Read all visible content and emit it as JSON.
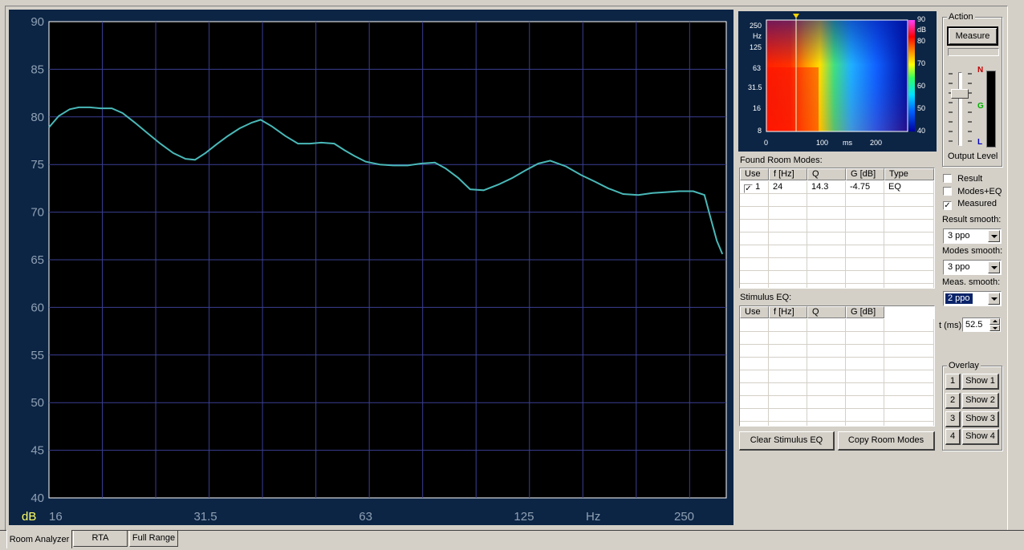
{
  "main_graph": {
    "y_ticks": [
      "90",
      "85",
      "80",
      "75",
      "70",
      "65",
      "60",
      "55",
      "50",
      "45",
      "40"
    ],
    "x_ticks": [
      "16",
      "31.5",
      "63",
      "125",
      "250"
    ],
    "y_unit": "dB",
    "x_unit": "Hz",
    "grid_color": "#3b3f94",
    "trace_color": "#4ab8b8",
    "background": "#000000"
  },
  "chart_data": {
    "type": "line",
    "title": "",
    "xlabel": "Hz",
    "ylabel": "dB",
    "x_scale": "log",
    "xlim": [
      16,
      300
    ],
    "ylim": [
      40,
      90
    ],
    "grid": true,
    "series": [
      {
        "x": [
          16,
          16.7,
          17.5,
          18.2,
          19.1,
          20,
          21,
          22,
          23.2,
          24.5,
          25.9,
          27.4,
          28.9,
          30.1,
          31.5,
          33,
          34.7,
          36.5,
          38.5,
          40,
          42,
          44.5,
          47,
          49.5,
          52,
          55,
          57.5,
          60,
          63,
          67,
          71,
          75.5,
          80,
          85,
          89,
          94,
          99,
          105,
          112,
          119,
          126,
          133,
          140,
          150,
          160,
          170,
          180,
          192,
          205,
          218,
          230,
          245,
          260,
          273,
          280,
          288,
          295
        ],
        "y": [
          78.9,
          80.1,
          80.8,
          81.0,
          81.0,
          80.9,
          80.9,
          80.4,
          79.4,
          78.3,
          77.2,
          76.2,
          75.6,
          75.5,
          76.2,
          77.1,
          78.0,
          78.8,
          79.4,
          79.7,
          79.0,
          78.0,
          77.2,
          77.2,
          77.3,
          77.2,
          76.5,
          75.9,
          75.3,
          75.0,
          74.9,
          74.9,
          75.1,
          75.2,
          74.6,
          73.6,
          72.4,
          72.3,
          72.9,
          73.6,
          74.4,
          75.1,
          75.4,
          74.8,
          73.9,
          73.2,
          72.5,
          71.9,
          71.8,
          72.0,
          72.1,
          72.2,
          72.2,
          71.8,
          69.5,
          67.0,
          65.6
        ]
      }
    ]
  },
  "spectrogram": {
    "y_ticks": [
      "250",
      "125",
      "63",
      "31.5",
      "16",
      "8"
    ],
    "y_unit": "Hz",
    "x_ticks": [
      "0",
      "100",
      "200"
    ],
    "x_unit": "ms",
    "colorbar_ticks": [
      "90",
      "80",
      "70",
      "60",
      "50",
      "40"
    ],
    "colorbar_unit": "dB",
    "marker_color": "#ffd700"
  },
  "found_modes": {
    "title": "Found Room Modes:",
    "columns": [
      "Use",
      "f [Hz]",
      "Q",
      "G [dB]",
      "Type"
    ],
    "rows": [
      {
        "use": "1",
        "checked": true,
        "f": "24",
        "q": "14.3",
        "g": "-4.75",
        "type": "EQ"
      }
    ]
  },
  "stimulus_eq": {
    "title": "Stimulus EQ:",
    "columns": [
      "Use",
      "f [Hz]",
      "Q",
      "G [dB]"
    ]
  },
  "buttons": {
    "clear_stimulus": "Clear Stimulus EQ",
    "copy_modes": "Copy Room Modes",
    "measure": "Measure"
  },
  "action": {
    "title": "Action",
    "output_level": "Output Level",
    "meter_labels": [
      "N",
      "G",
      "L"
    ]
  },
  "display": {
    "result": {
      "label": "Result",
      "checked": false
    },
    "modes_eq": {
      "label": "Modes+EQ",
      "checked": false
    },
    "measured": {
      "label": "Measured",
      "checked": true
    },
    "result_smooth_label": "Result smooth:",
    "result_smooth": "3 ppo",
    "modes_smooth_label": "Modes smooth:",
    "modes_smooth": "3 ppo",
    "meas_smooth_label": "Meas. smooth:",
    "meas_smooth": "2 ppo",
    "t_label": "t (ms)",
    "t_value": "52.5"
  },
  "overlay": {
    "title": "Overlay",
    "items": [
      {
        "num": "1",
        "show": "Show 1"
      },
      {
        "num": "2",
        "show": "Show 2"
      },
      {
        "num": "3",
        "show": "Show 3"
      },
      {
        "num": "4",
        "show": "Show 4"
      }
    ]
  },
  "tabs": [
    "Room Analyzer",
    "RTA",
    "Full Range"
  ]
}
